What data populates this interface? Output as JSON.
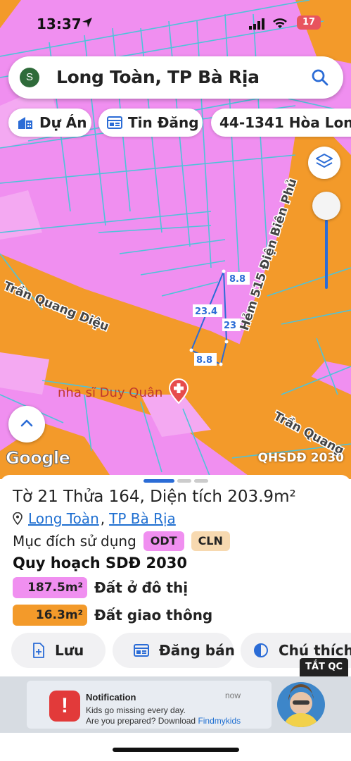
{
  "status_bar": {
    "time": "13:37",
    "battery": "17"
  },
  "search": {
    "avatar_letter": "S",
    "query": "Long Toàn, TP Bà Rịa"
  },
  "chips": {
    "du_an": "Dự Án",
    "tin_dang": "Tin Đăng",
    "parcel": "44-1341 Hòa Lon"
  },
  "map": {
    "streets": [
      "Trần Quang Diệu",
      "Hẻm 515 Điện Biên Phủ",
      "Trần Quang"
    ],
    "dimensions": [
      "8.8",
      "23.4",
      "23",
      "8.8"
    ],
    "poi_label": "nha sĩ Duy Quân",
    "google_logo": "Google",
    "plan_badge": "QHSDĐ 2030",
    "colors": {
      "residential": "#f08ff0",
      "traffic": "#f39a2a",
      "parcel_line": "#4ec3d9",
      "selected": "#2b6cd6"
    }
  },
  "sheet": {
    "title": "Tờ 21 Thửa 164, Diện tích 203.9m²",
    "location_ward": "Long Toàn",
    "location_city": "TP Bà Rịa",
    "purpose_label": "Mục đích sử dụng",
    "purpose_tags": [
      {
        "code": "ODT",
        "color": "#f08ff0"
      },
      {
        "code": "CLN",
        "color": "#f7d9b0"
      }
    ],
    "plan_title": "Quy hoạch SDĐ 2030",
    "plan_items": [
      {
        "area": "187.5m²",
        "label": "Đất ở đô thị",
        "color": "#f08ff0"
      },
      {
        "area": "16.3m²",
        "label": "Đất giao thông",
        "color": "#f39a2a"
      }
    ],
    "actions": {
      "save": "Lưu",
      "sell": "Đăng bán",
      "note": "Chú thích"
    }
  },
  "ad": {
    "close_label": "TẮT QC",
    "title": "Notification",
    "time": "now",
    "line1": "Kids go missing every day.",
    "line2_prefix": "Are you prepared? Download ",
    "line2_link": "Findmykids"
  }
}
